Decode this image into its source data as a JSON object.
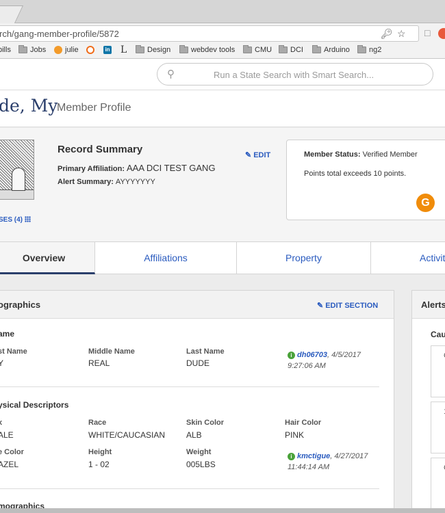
{
  "browser": {
    "url": "rch/gang-member-profile/5872",
    "bookmarks": [
      {
        "label": "bills",
        "type": "folder"
      },
      {
        "label": "Jobs",
        "type": "folder"
      },
      {
        "label": "julie",
        "type": "julie"
      },
      {
        "label": "",
        "type": "orange"
      },
      {
        "label": "",
        "type": "linkedin"
      },
      {
        "label": "L",
        "type": "serif"
      },
      {
        "label": "Design",
        "type": "folder"
      },
      {
        "label": "webdev tools",
        "type": "folder"
      },
      {
        "label": "CMU",
        "type": "folder"
      },
      {
        "label": "DCI",
        "type": "folder"
      },
      {
        "label": "Arduino",
        "type": "folder"
      },
      {
        "label": "ng2",
        "type": "folder"
      }
    ]
  },
  "header": {
    "search_placeholder": "Run a State Search with Smart Search..."
  },
  "title": {
    "name": "de, My",
    "subtitle": "Member Profile"
  },
  "summary": {
    "title": "Record Summary",
    "primary_affiliation_label": "Primary Affiliation:",
    "primary_affiliation_value": "AAA DCI TEST GANG",
    "alert_summary_label": "Alert Summary:",
    "alert_summary_value": "AYYYYYYY",
    "edit_label": "EDIT",
    "images_link": "SES (4)",
    "status_label": "Member Status:",
    "status_value": "Verified Member",
    "points_text": "Points total exceeds 10 points.",
    "badge": "G"
  },
  "tabs": [
    "Overview",
    "Affiliations",
    "Property",
    "Activit"
  ],
  "demographics": {
    "title": "ographics",
    "edit_section": "EDIT SECTION",
    "name_section": "ame",
    "name_fields": [
      {
        "label": "st Name",
        "value": "Y"
      },
      {
        "label": "Middle Name",
        "value": "REAL"
      },
      {
        "label": "Last Name",
        "value": "DUDE"
      }
    ],
    "name_audit_user": "dh06703",
    "name_audit_rest": ", 4/5/2017",
    "name_audit_time": "9:27:06 AM",
    "physical_section": "ysical Descriptors",
    "physical_row1": [
      {
        "label": "x",
        "value": "ALE"
      },
      {
        "label": "Race",
        "value": "WHITE/CAUCASIAN"
      },
      {
        "label": "Skin Color",
        "value": "ALB"
      },
      {
        "label": "Hair Color",
        "value": "PINK"
      }
    ],
    "physical_row2": [
      {
        "label": "e Color",
        "value": "AZEL"
      },
      {
        "label": "Height",
        "value": "1 - 02"
      },
      {
        "label": "Weight",
        "value": "005LBS"
      }
    ],
    "physical_audit_user": "kmctigue",
    "physical_audit_rest": ", 4/27/2017",
    "physical_audit_time": "11:44:14 AM",
    "next_section": "mographics"
  },
  "alerts": {
    "title": "Alerts",
    "caution": "Cau",
    "boxes": [
      "C",
      "1",
      "C"
    ]
  }
}
